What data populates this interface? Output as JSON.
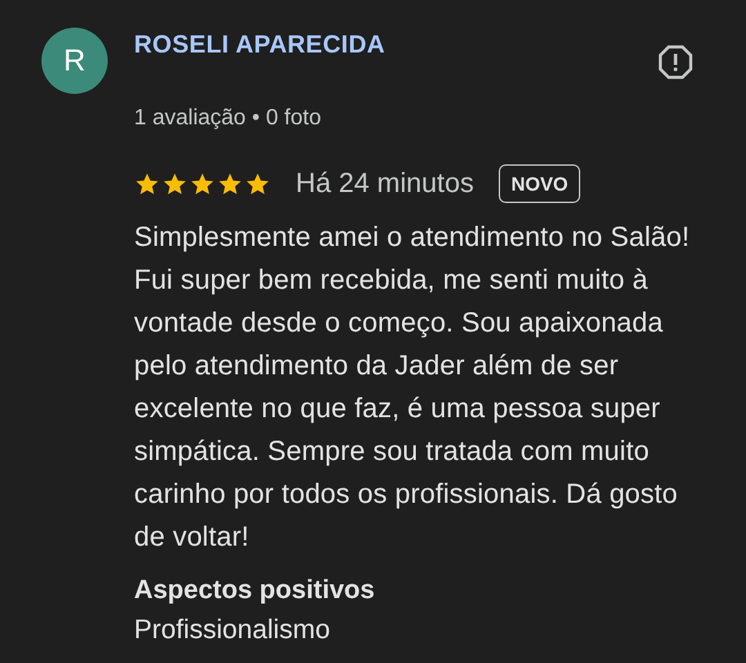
{
  "review": {
    "avatar_letter": "R",
    "author": "ROSELI APARECIDA",
    "meta": "1 avaliação • 0 foto",
    "stars": 5,
    "time": "Há 24 minutos",
    "badge": "NOVO",
    "text": "Simplesmente amei o atendimento no Salão! Fui super bem recebida, me senti muito à vontade desde o começo. Sou apaixonada pelo atendimento da Jader além de ser excelente no que faz, é uma pessoa super simpática. Sempre sou tratada com muito carinho por todos os profissionais. Dá gosto de voltar!",
    "aspects_title": "Aspectos positivos",
    "aspects": [
      "Profissionalismo"
    ]
  }
}
